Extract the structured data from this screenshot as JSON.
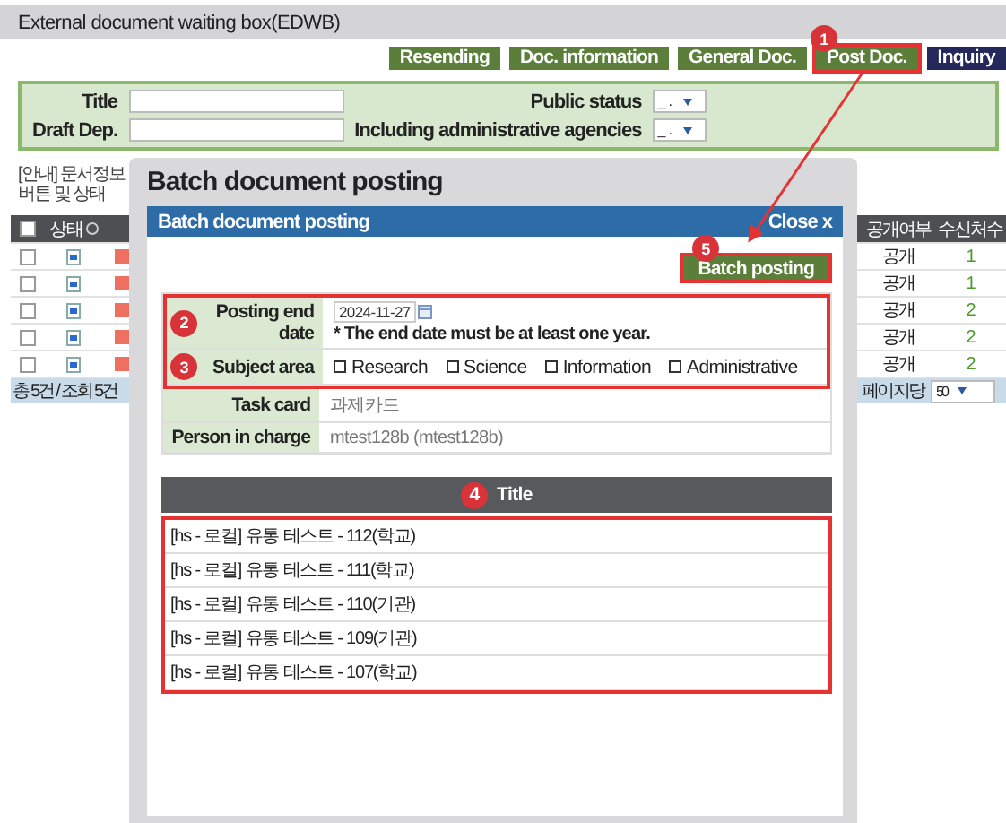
{
  "page": {
    "title": "External document waiting box(EDWB)",
    "buttons": [
      {
        "label": "Resending",
        "kind": "action",
        "highlighted": false
      },
      {
        "label": "Doc. information",
        "kind": "action",
        "highlighted": false
      },
      {
        "label": "General Doc.",
        "kind": "action",
        "highlighted": false
      },
      {
        "label": "Post  Doc.",
        "kind": "action",
        "highlighted": true,
        "badge": "1"
      },
      {
        "label": "Inquiry",
        "kind": "query",
        "highlighted": false
      }
    ],
    "search": {
      "fields": [
        {
          "label": "Title"
        },
        {
          "label": "Draft Dep."
        }
      ],
      "selects": [
        {
          "label": "Public status",
          "value": "_ ."
        },
        {
          "label": "Including administrative agencies",
          "value": "_ ."
        }
      ]
    },
    "notice": "[안내] 문서정보 버튼 및 상태",
    "table": {
      "all_checked": false,
      "status_header": "상태",
      "public_header": "공개여부",
      "recipients_header": "수신처수",
      "rows": [
        {
          "checked": false,
          "public": "공개",
          "recipients": "1"
        },
        {
          "checked": false,
          "public": "공개",
          "recipients": "1"
        },
        {
          "checked": false,
          "public": "공개",
          "recipients": "2"
        },
        {
          "checked": false,
          "public": "공개",
          "recipients": "2"
        },
        {
          "checked": false,
          "public": "공개",
          "recipients": "2"
        }
      ],
      "total": "총 5건 / 조회 5건",
      "per_page_label": "페이지당",
      "per_page": "50"
    }
  },
  "modal": {
    "title": "Batch document posting",
    "dialog": {
      "title": "Batch document posting",
      "close": "Close x",
      "action": {
        "label": "Batch posting",
        "badge": "5",
        "highlighted": true
      },
      "form": [
        {
          "label": "Posting end date",
          "kind": "date",
          "value": "2024-11-27",
          "note": "* The end date must be at least one year.",
          "badge": "2",
          "highlighted": true
        },
        {
          "label": "Subject area",
          "kind": "checkboxes",
          "badge": "3",
          "highlighted": true,
          "options": [
            {
              "label": "Research",
              "checked": false
            },
            {
              "label": "Science",
              "checked": false
            },
            {
              "label": "Information",
              "checked": false
            },
            {
              "label": "Administrative",
              "checked": false
            }
          ]
        },
        {
          "label": "Task card",
          "kind": "text",
          "value": "과제카드",
          "highlighted": false
        },
        {
          "label": "Person in charge",
          "kind": "text",
          "value": "mtest128b (mtest128b)",
          "highlighted": false
        }
      ],
      "titles": {
        "header": "Title",
        "badge": "4",
        "highlighted": true,
        "items": [
          "[hs - 로컬] 유통 테스트 - 112(학교)",
          "[hs - 로컬] 유통 테스트 - 111(학교)",
          "[hs - 로컬] 유통 테스트 - 110(기관)",
          "[hs - 로컬] 유통 테스트 - 109(기관)",
          "[hs - 로컬] 유통 테스트 - 107(학교)"
        ]
      }
    }
  }
}
